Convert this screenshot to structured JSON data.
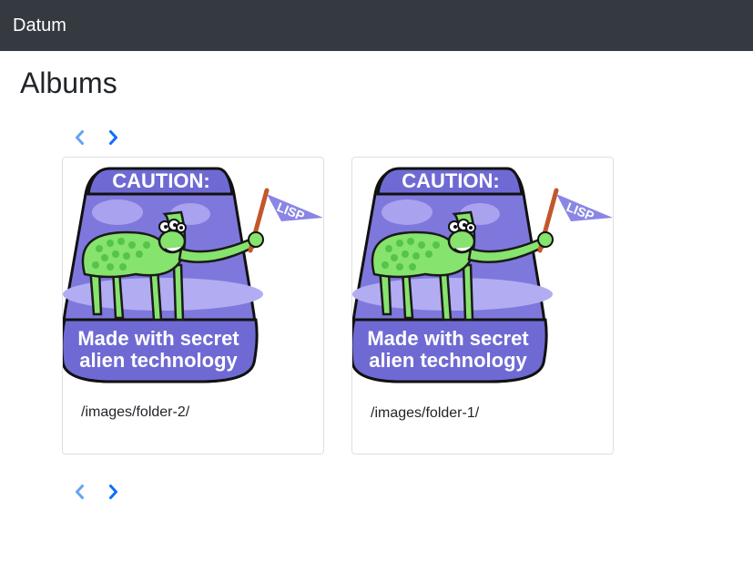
{
  "navbar": {
    "brand": "Datum"
  },
  "page": {
    "title": "Albums"
  },
  "pagination": {
    "prev_icon": "chevron-left-icon",
    "next_icon": "chevron-right-icon",
    "prev_color": "#63a4f0",
    "next_color": "#0d6efd"
  },
  "badge": {
    "top_text": "CAUTION:",
    "flag_text": "LISP",
    "line1": "Made with secret",
    "line2": "alien technology"
  },
  "albums": [
    {
      "path": "/images/folder-2/"
    },
    {
      "path": "/images/folder-1/"
    }
  ]
}
